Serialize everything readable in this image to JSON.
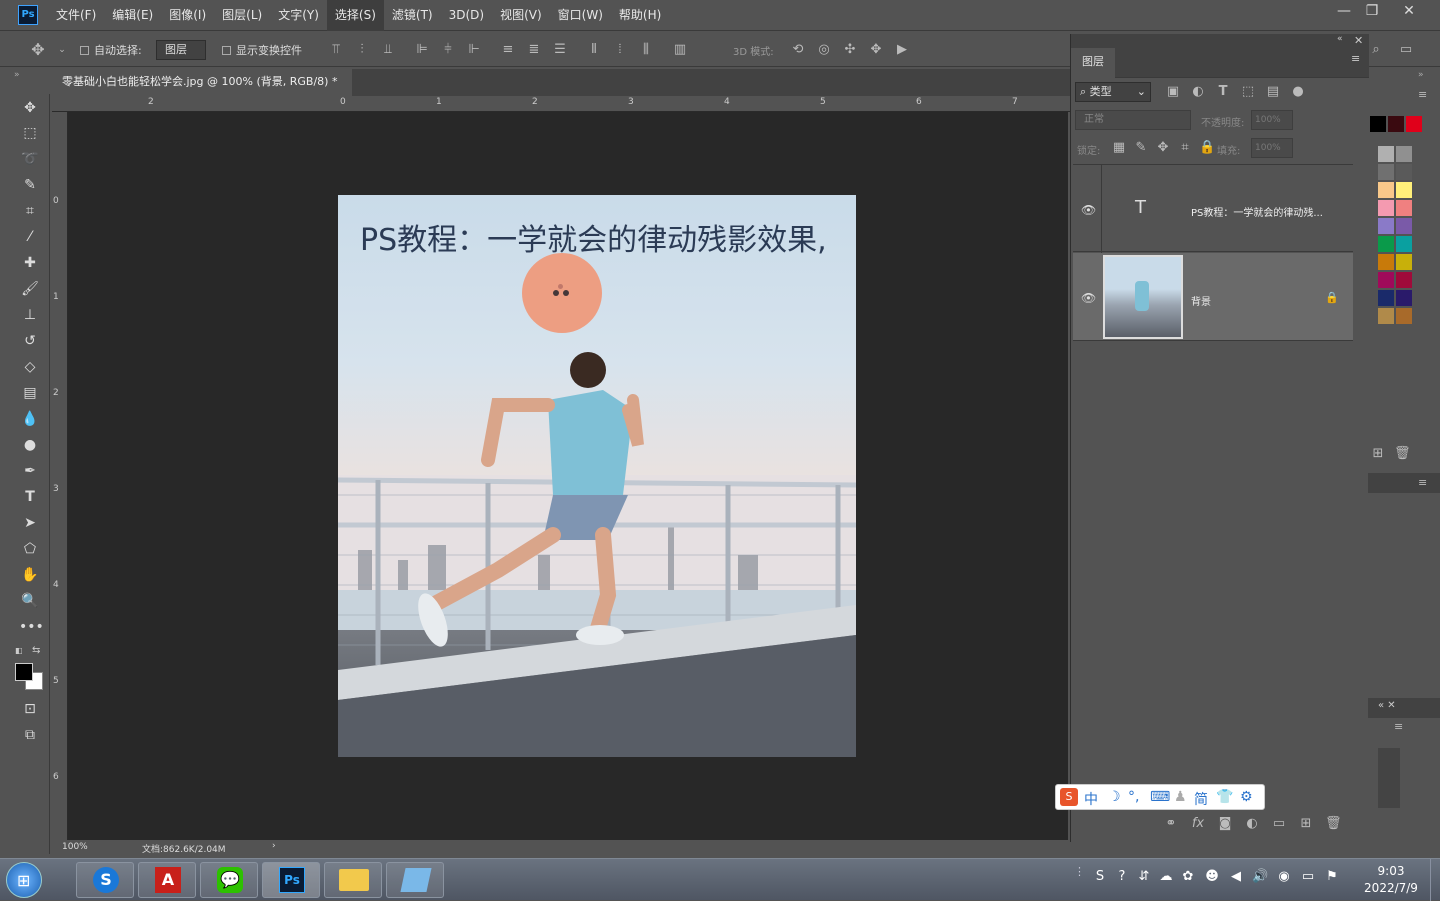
{
  "app": {
    "logo": "Ps"
  },
  "menu": [
    "文件(F)",
    "编辑(E)",
    "图像(I)",
    "图层(L)",
    "文字(Y)",
    "选择(S)",
    "滤镜(T)",
    "3D(D)",
    "视图(V)",
    "窗口(W)",
    "帮助(H)"
  ],
  "window_controls": {
    "minimize": "—",
    "restore": "❐",
    "close": "✕"
  },
  "options": {
    "auto_select_label": "自动选择:",
    "auto_select_value": "图层",
    "show_transform_label": "显示变换控件",
    "mode_3d_label": "3D 模式:"
  },
  "document": {
    "tab_title": "零基础小白也能轻松学会.jpg @ 100% (背景, RGB/8) *",
    "close": "×",
    "image_text": "PS教程：一学就会的律动残影效果,",
    "zoom": "100%",
    "doc_size": "文档:862.6K/2.04M",
    "ruler_top": [
      "2",
      "0",
      "1",
      "2",
      "3",
      "4",
      "5",
      "6",
      "7"
    ],
    "ruler_left": [
      "0",
      "1",
      "2",
      "3",
      "4",
      "5",
      "6"
    ]
  },
  "layers_panel": {
    "title": "图层",
    "filter_label": "类型",
    "blend_mode": "正常",
    "opacity_label": "不透明度:",
    "opacity_value": "100%",
    "lock_label": "锁定:",
    "fill_label": "填充:",
    "fill_value": "100%",
    "layers": [
      {
        "name": "PS教程：一学就会的律动残...",
        "type_glyph": "T",
        "selected": false
      },
      {
        "name": "背景",
        "selected": true,
        "locked": true
      }
    ]
  },
  "swatches": [
    "#000000",
    "#3a0a10",
    "#e0001a",
    "#b0b0b0",
    "#909090",
    "#707070",
    "#5a5a5a",
    "#f8c88a",
    "#fff07a",
    "#f49ab0",
    "#f08080",
    "#8a7ac8",
    "#7a5aa8",
    "#0a9a4a",
    "#0aa0a0",
    "#c87a0a",
    "#c8b00a",
    "#a00a5a",
    "#a00a3a",
    "#1a2a6a",
    "#2a1a6a",
    "#b08a4a",
    "#a86a2a"
  ],
  "ime": {
    "items": [
      "中",
      "简"
    ]
  },
  "taskbar": {
    "time": "9:03",
    "date": "2022/7/9"
  },
  "colors": {
    "ui_bg": "#535353",
    "canvas_bg": "#282828",
    "panel_dark": "#424242",
    "accent": "#31a8ff"
  }
}
